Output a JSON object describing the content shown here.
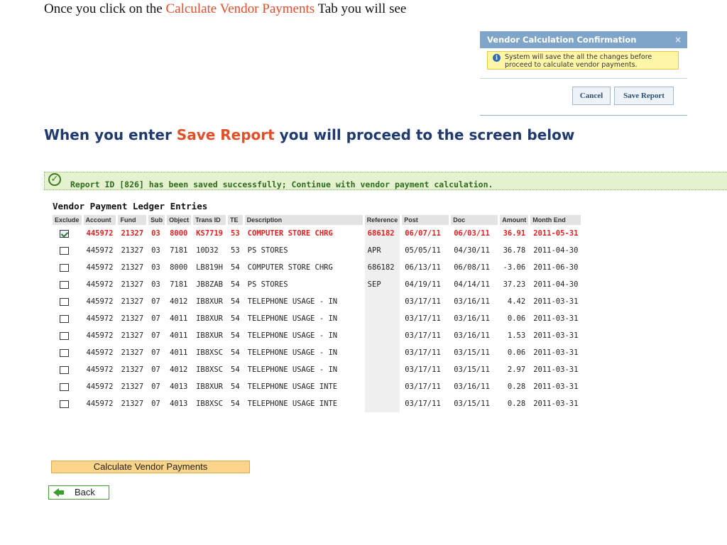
{
  "intro": {
    "prefix": "Once you click on the ",
    "highlight": "Calculate Vendor Payments",
    "suffix": " Tab you will see"
  },
  "dialog": {
    "title": "Vendor Calculation Confirmation",
    "close_glyph": "×",
    "message": "System will save the all the changes before proceed to calculate vendor payments.",
    "cancel_label": "Cancel",
    "save_label": "Save Report"
  },
  "heading2": {
    "prefix": "When you enter ",
    "highlight": "Save Report",
    "suffix": " you will proceed to the  screen below"
  },
  "success": {
    "message": "Report ID [826] has been saved successfully; Continue with vendor payment calculation."
  },
  "ledger": {
    "title": "Vendor Payment Ledger Entries",
    "columns": [
      "Exclude",
      "Account",
      "Fund",
      "Sub",
      "Object",
      "Trans ID",
      "TE",
      "Description",
      "Reference",
      "Post",
      "Doc",
      "Amount",
      "Month End"
    ],
    "rows": [
      {
        "checked": true,
        "account": "445972",
        "fund": "21327",
        "sub": "03",
        "object": "8000",
        "trans_id": "KS7719",
        "te": "53",
        "description": "COMPUTER STORE CHRG",
        "reference": "686182",
        "post": "06/07/11",
        "doc": "06/03/11",
        "amount": "36.91",
        "month_end": "2011-05-31"
      },
      {
        "checked": false,
        "account": "445972",
        "fund": "21327",
        "sub": "03",
        "object": "7181",
        "trans_id": "10D32",
        "te": "53",
        "description": "PS STORES",
        "reference": "APR",
        "post": "05/05/11",
        "doc": "04/30/11",
        "amount": "36.78",
        "month_end": "2011-04-30"
      },
      {
        "checked": false,
        "account": "445972",
        "fund": "21327",
        "sub": "03",
        "object": "8000",
        "trans_id": "LB819H",
        "te": "54",
        "description": "COMPUTER STORE CHRG",
        "reference": "686182",
        "post": "06/13/11",
        "doc": "06/08/11",
        "amount": "-3.06",
        "month_end": "2011-06-30"
      },
      {
        "checked": false,
        "account": "445972",
        "fund": "21327",
        "sub": "03",
        "object": "7181",
        "trans_id": "JB8ZAB",
        "te": "54",
        "description": "PS STORES",
        "reference": "SEP",
        "post": "04/19/11",
        "doc": "04/14/11",
        "amount": "37.23",
        "month_end": "2011-04-30"
      },
      {
        "checked": false,
        "account": "445972",
        "fund": "21327",
        "sub": "07",
        "object": "4012",
        "trans_id": "IB8XUR",
        "te": "54",
        "description": "TELEPHONE USAGE - IN",
        "reference": "",
        "post": "03/17/11",
        "doc": "03/16/11",
        "amount": "4.42",
        "month_end": "2011-03-31"
      },
      {
        "checked": false,
        "account": "445972",
        "fund": "21327",
        "sub": "07",
        "object": "4011",
        "trans_id": "IB8XUR",
        "te": "54",
        "description": "TELEPHONE USAGE - IN",
        "reference": "",
        "post": "03/17/11",
        "doc": "03/16/11",
        "amount": "0.06",
        "month_end": "2011-03-31"
      },
      {
        "checked": false,
        "account": "445972",
        "fund": "21327",
        "sub": "07",
        "object": "4011",
        "trans_id": "IB8XUR",
        "te": "54",
        "description": "TELEPHONE USAGE - IN",
        "reference": "",
        "post": "03/17/11",
        "doc": "03/16/11",
        "amount": "1.53",
        "month_end": "2011-03-31"
      },
      {
        "checked": false,
        "account": "445972",
        "fund": "21327",
        "sub": "07",
        "object": "4011",
        "trans_id": "IB8XSC",
        "te": "54",
        "description": "TELEPHONE USAGE - IN",
        "reference": "",
        "post": "03/17/11",
        "doc": "03/15/11",
        "amount": "0.06",
        "month_end": "2011-03-31"
      },
      {
        "checked": false,
        "account": "445972",
        "fund": "21327",
        "sub": "07",
        "object": "4012",
        "trans_id": "IB8XSC",
        "te": "54",
        "description": "TELEPHONE USAGE - IN",
        "reference": "",
        "post": "03/17/11",
        "doc": "03/15/11",
        "amount": "2.97",
        "month_end": "2011-03-31"
      },
      {
        "checked": false,
        "account": "445972",
        "fund": "21327",
        "sub": "07",
        "object": "4013",
        "trans_id": "IB8XUR",
        "te": "54",
        "description": "TELEPHONE USAGE INTE",
        "reference": "",
        "post": "03/17/11",
        "doc": "03/16/11",
        "amount": "0.28",
        "month_end": "2011-03-31"
      },
      {
        "checked": false,
        "account": "445972",
        "fund": "21327",
        "sub": "07",
        "object": "4013",
        "trans_id": "IB8XSC",
        "te": "54",
        "description": "TELEPHONE USAGE INTE",
        "reference": "",
        "post": "03/17/11",
        "doc": "03/15/11",
        "amount": "0.28",
        "month_end": "2011-03-31"
      }
    ]
  },
  "actions": {
    "calculate_label": "Calculate Vendor Payments",
    "back_label": "Back"
  },
  "colors": {
    "highlight": "#e0502a",
    "selected_row": "#e02020",
    "success_bg": "#e4f2cf",
    "dialog_title_bg": "#7fa6c8",
    "calc_button_bg": "#fdd58a"
  },
  "icons": {
    "dialog_info": "info-icon",
    "dialog_close": "close-icon",
    "success": "check-circle-icon",
    "back": "back-arrow-icon"
  }
}
